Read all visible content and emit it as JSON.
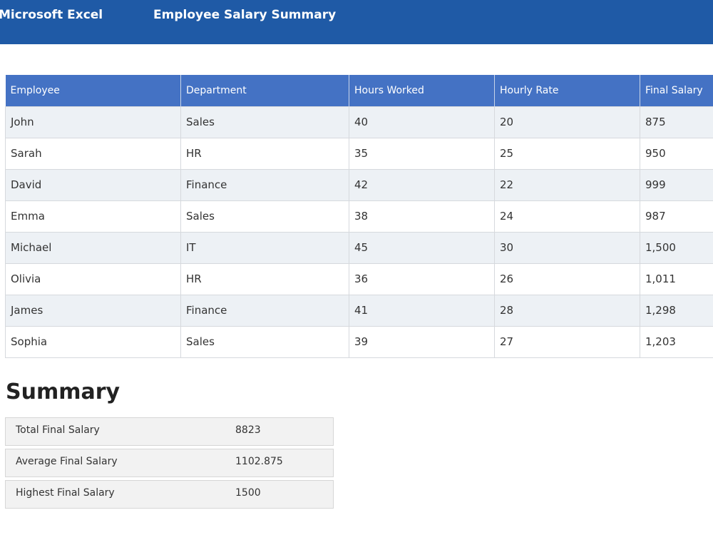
{
  "app": {
    "name": "Microsoft Excel",
    "document_title": "Employee Salary Summary"
  },
  "table": {
    "headers": [
      "Employee",
      "Department",
      "Hours Worked",
      "Hourly Rate",
      "Final Salary"
    ],
    "rows": [
      [
        "John",
        "Sales",
        "40",
        "20",
        "875"
      ],
      [
        "Sarah",
        "HR",
        "35",
        "25",
        "950"
      ],
      [
        "David",
        "Finance",
        "42",
        "22",
        "999"
      ],
      [
        "Emma",
        "Sales",
        "38",
        "24",
        "987"
      ],
      [
        "Michael",
        "IT",
        "45",
        "30",
        "1,500"
      ],
      [
        "Olivia",
        "HR",
        "36",
        "26",
        "1,011"
      ],
      [
        "James",
        "Finance",
        "41",
        "28",
        "1,298"
      ],
      [
        "Sophia",
        "Sales",
        "39",
        "27",
        "1,203"
      ]
    ]
  },
  "summary": {
    "heading": "Summary",
    "items": [
      {
        "label": "Total Final Salary",
        "value": "8823"
      },
      {
        "label": "Average Final Salary",
        "value": "1102.875"
      },
      {
        "label": "Highest Final Salary",
        "value": "1500"
      }
    ]
  },
  "colors": {
    "title_bar": "#1f5aa6",
    "header_row": "#4472c4",
    "striped_row": "#edf1f5",
    "summary_box": "#f2f2f2"
  }
}
